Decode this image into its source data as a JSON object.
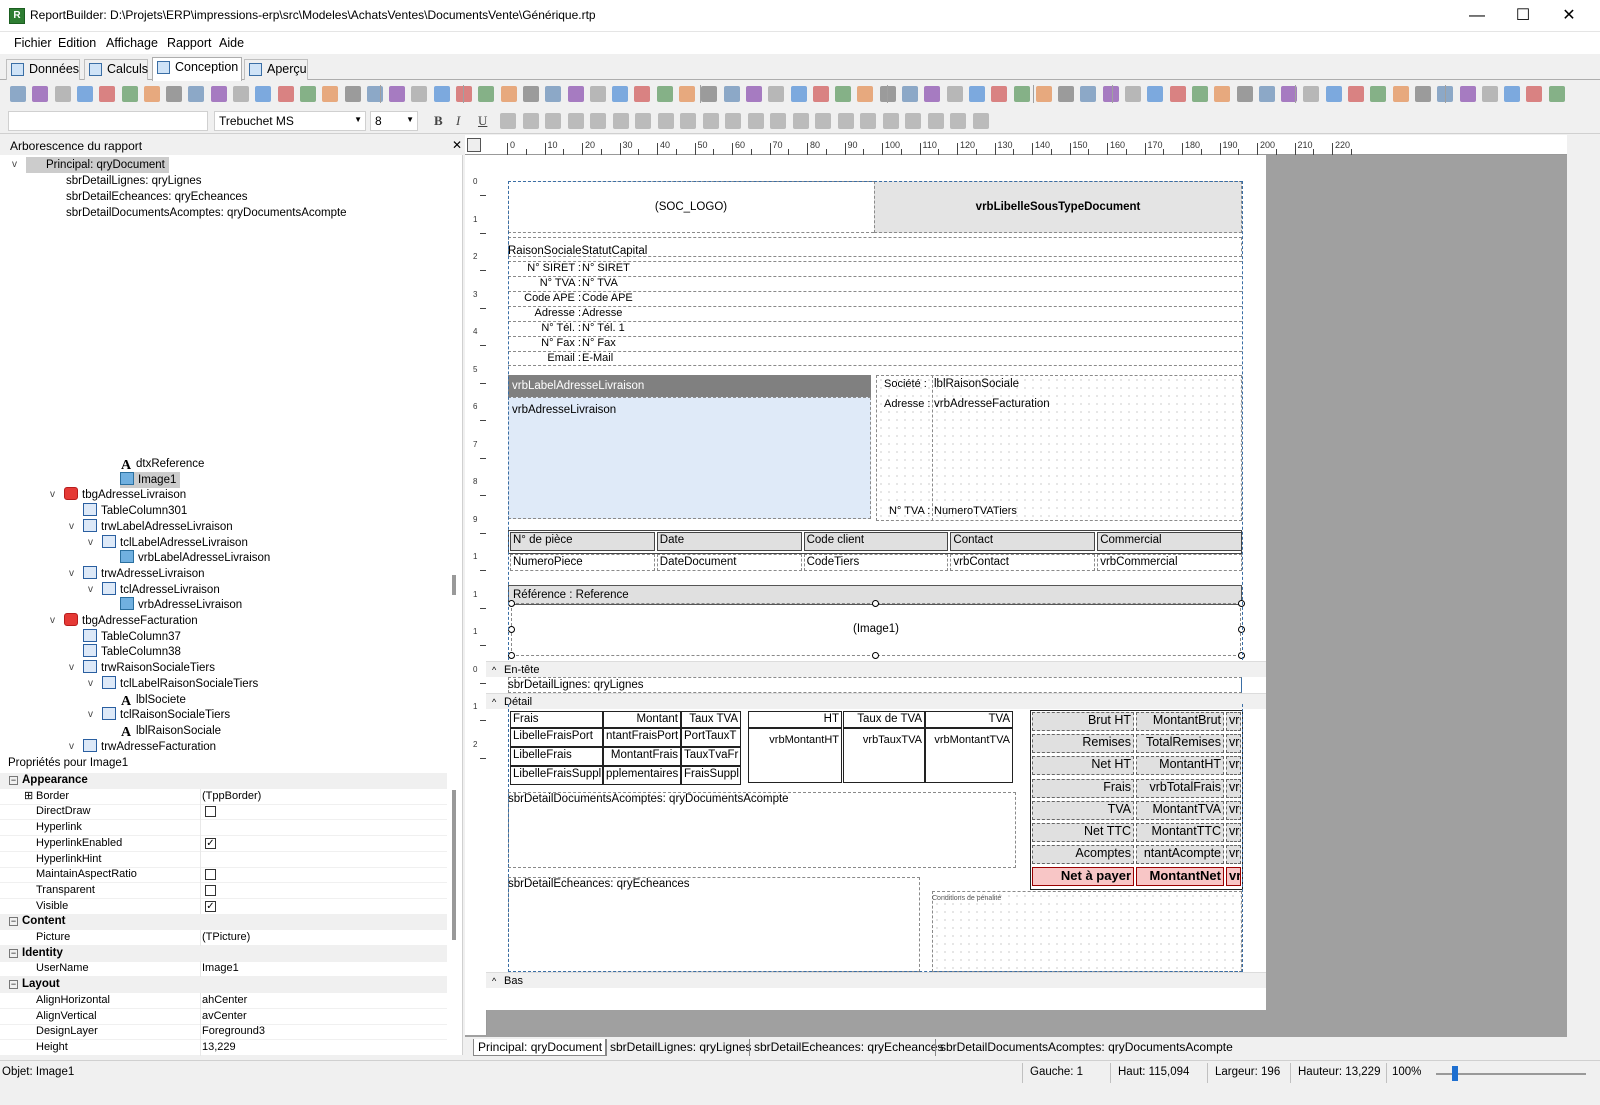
{
  "window": {
    "title": "ReportBuilder: D:\\Projets\\ERP\\impressions-erp\\src\\Modeles\\AchatsVentes\\DocumentsVente\\Générique.rtp",
    "app_icon": "R",
    "controls": {
      "minimize": "—",
      "maximize": "☐",
      "close": "✕"
    }
  },
  "menu": [
    "Fichier",
    "Edition",
    "Affichage",
    "Rapport",
    "Aide"
  ],
  "main_tabs": [
    {
      "label": "Données",
      "icon": "data-icon"
    },
    {
      "label": "Calculs",
      "icon": "calc-icon"
    },
    {
      "label": "Conception",
      "icon": "design-icon",
      "active": true
    },
    {
      "label": "Aperçu",
      "icon": "preview-icon"
    }
  ],
  "format_toolbar": {
    "font": "Trebuchet MS",
    "size": "8",
    "bold": "B",
    "italic": "I",
    "underline": "U"
  },
  "tree": {
    "header": "Arborescence du rapport",
    "close": "✕",
    "top_nodes": [
      "Principal: qryDocument",
      "sbrDetailLignes: qryLignes",
      "sbrDetailEcheances: qryEcheances",
      "sbrDetailDocumentsAcomptes: qryDocumentsAcompte"
    ],
    "components": [
      {
        "label": "dtxReference",
        "icon": "text"
      },
      {
        "label": "Image1",
        "icon": "img",
        "selected": true
      },
      {
        "label": "tbgAdresseLivraison",
        "icon": "grp",
        "chev": "v"
      },
      {
        "label": "TableColumn301",
        "icon": "tbl"
      },
      {
        "label": "trwLabelAdresseLivraison",
        "icon": "tbl",
        "chev": "v"
      },
      {
        "label": "tclLabelAdresseLivraison",
        "icon": "tbl",
        "chev": "v"
      },
      {
        "label": "vrbLabelAdresseLivraison",
        "icon": "img"
      },
      {
        "label": "trwAdresseLivraison",
        "icon": "tbl",
        "chev": "v"
      },
      {
        "label": "tclAdresseLivraison",
        "icon": "tbl",
        "chev": "v"
      },
      {
        "label": "vrbAdresseLivraison",
        "icon": "img"
      },
      {
        "label": "tbgAdresseFacturation",
        "icon": "grp",
        "chev": "v"
      },
      {
        "label": "TableColumn37",
        "icon": "tbl"
      },
      {
        "label": "TableColumn38",
        "icon": "tbl"
      },
      {
        "label": "trwRaisonSocialeTiers",
        "icon": "tbl",
        "chev": "v"
      },
      {
        "label": "tclLabelRaisonSocialeTiers",
        "icon": "tbl",
        "chev": "v"
      },
      {
        "label": "lblSociete",
        "icon": "text"
      },
      {
        "label": "tclRaisonSocialeTiers",
        "icon": "tbl",
        "chev": "v"
      },
      {
        "label": "lblRaisonSociale",
        "icon": "text"
      },
      {
        "label": "trwAdresseFacturation",
        "icon": "tbl",
        "chev": "v"
      }
    ]
  },
  "props": {
    "title": "Propriétés pour Image1",
    "rows": [
      {
        "cat": "Appearance"
      },
      {
        "name": "Border",
        "value": "(TppBorder)",
        "expand": "⊞"
      },
      {
        "name": "DirectDraw",
        "check": false
      },
      {
        "name": "Hyperlink",
        "value": ""
      },
      {
        "name": "HyperlinkEnabled",
        "check": true
      },
      {
        "name": "HyperlinkHint",
        "value": ""
      },
      {
        "name": "MaintainAspectRatio",
        "check": false
      },
      {
        "name": "Transparent",
        "check": false
      },
      {
        "name": "Visible",
        "check": true
      },
      {
        "cat": "Content"
      },
      {
        "name": "Picture",
        "value": "(TPicture)"
      },
      {
        "cat": "Identity"
      },
      {
        "name": "UserName",
        "value": "Image1"
      },
      {
        "cat": "Layout"
      },
      {
        "name": "AlignHorizontal",
        "value": "ahCenter"
      },
      {
        "name": "AlignVertical",
        "value": "avCenter"
      },
      {
        "name": "DesignLayer",
        "value": "Foreground3"
      },
      {
        "name": "Height",
        "value": "13,229"
      }
    ]
  },
  "ruler_h": [
    "0",
    "10",
    "20",
    "30",
    "40",
    "50",
    "60",
    "70",
    "80",
    "90",
    "100",
    "110",
    "120",
    "130",
    "140",
    "150",
    "160",
    "170",
    "180",
    "190",
    "200",
    "210",
    "220"
  ],
  "ruler_v": [
    "0",
    "1",
    "2",
    "3",
    "4",
    "5",
    "6",
    "7",
    "8",
    "9",
    "1",
    "1",
    "1",
    "0",
    "1",
    "2"
  ],
  "report": {
    "soc_logo": "(SOC_LOGO)",
    "sous_type": "vrbLibelleSousTypeDocument",
    "raison_sociale": "RaisonSocialeStatutCapital",
    "company_lines": [
      {
        "label": "N° SIRET :",
        "value": "N° SIRET"
      },
      {
        "label": "N° TVA :",
        "value": "N° TVA"
      },
      {
        "label": "Code APE :",
        "value": "Code APE"
      },
      {
        "label": "Adresse :",
        "value": "Adresse"
      },
      {
        "label": "N° Tél. :",
        "value": "N° Tél. 1"
      },
      {
        "label": "N° Fax :",
        "value": "N° Fax"
      },
      {
        "label": "Email :",
        "value": "E-Mail"
      }
    ],
    "livraison_label": "vrbLabelAdresseLivraison",
    "livraison_adresse": "vrbAdresseLivraison",
    "societe_label": "Société :",
    "societe_value": "lblRaisonSociale",
    "adresse_label": "Adresse :",
    "adresse_value": "vrbAdresseFacturation",
    "tva_label": "N° TVA :",
    "tva_value": "NumeroTVATiers",
    "doc_headers": [
      "N° de pièce",
      "Date",
      "Code client",
      "Contact",
      "Commercial"
    ],
    "doc_values": [
      "NumeroPiece",
      "DateDocument",
      "CodeTiers",
      "vrbContact",
      "vrbCommercial"
    ],
    "reference": "Référence : Reference",
    "image1": "(Image1)",
    "band_entete": "En-tête",
    "sub_lignes": "sbrDetailLignes: qryLignes",
    "band_detail": "Détail",
    "frais_headers": [
      "Frais",
      "Montant",
      "Taux TVA"
    ],
    "frais_rows": [
      [
        "LibelleFraisPort",
        "ntantFraisPort",
        "PortTauxT"
      ],
      [
        "LibelleFrais",
        "MontantFrais",
        "TauxTvaFr"
      ],
      [
        "LibelleFraisSuppl",
        "pplementaires",
        "FraisSuppl"
      ]
    ],
    "tva_headers": [
      "HT",
      "Taux de TVA",
      "TVA"
    ],
    "tva_values": [
      "vrbMontantHT",
      "vrbTauxTVA",
      "vrbMontantTVA"
    ],
    "totals": [
      {
        "label": "Brut HT",
        "value": "MontantBrut",
        "extra": "vr"
      },
      {
        "label": "Remises",
        "value": "TotalRemises",
        "extra": "vr"
      },
      {
        "label": "Net HT",
        "value": "MontantHT",
        "extra": "vr"
      },
      {
        "label": "Frais",
        "value": "vrbTotalFrais",
        "extra": "vr"
      },
      {
        "label": "TVA",
        "value": "MontantTVA",
        "extra": "vr"
      },
      {
        "label": "Net TTC",
        "value": "MontantTTC",
        "extra": "vr"
      },
      {
        "label": "Acomptes",
        "value": "ntantAcompte",
        "extra": "vr"
      },
      {
        "label": "Net à payer",
        "value": "MontantNet",
        "extra": "vr",
        "highlight": true
      }
    ],
    "sub_acomptes": "sbrDetailDocumentsAcomptes: qryDocumentsAcompte",
    "sub_echeances": "sbrDetailEcheances: qryEcheances",
    "conditions": "Conditions de pénalité",
    "band_bas": "Bas"
  },
  "bottom_tabs": [
    "Principal: qryDocument",
    "sbrDetailLignes: qryLignes",
    "sbrDetailEcheances: qryEcheances",
    "sbrDetailDocumentsAcomptes: qryDocumentsAcompte"
  ],
  "status": {
    "objet": "Objet: Image1",
    "gauche": "Gauche: 1",
    "haut": "Haut: 115,094",
    "largeur": "Largeur: 196",
    "hauteur": "Hauteur: 13,229",
    "zoom": "100%"
  },
  "colors": {
    "livraison_bg": "#808080",
    "livraison_box": "#dfeaf8",
    "highlight": "#f8c6c6",
    "selected": "#cccccc"
  }
}
